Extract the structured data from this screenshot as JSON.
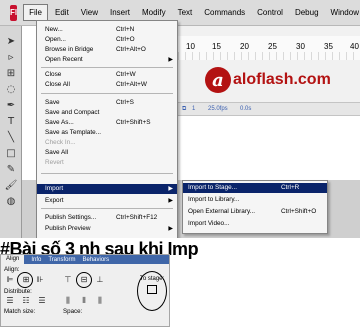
{
  "app": {
    "logo": "Fl"
  },
  "menubar": [
    "File",
    "Edit",
    "View",
    "Insert",
    "Modify",
    "Text",
    "Commands",
    "Control",
    "Debug",
    "Window"
  ],
  "ruler": [
    "10",
    "15",
    "20",
    "25",
    "30",
    "35",
    "40"
  ],
  "watermark": {
    "letter": "a",
    "text": "aloflash.com"
  },
  "status_strip": {
    "frame": "1",
    "fps": "25.0fps",
    "time": "0.0s"
  },
  "file_menu": [
    {
      "label": "New...",
      "shortcut": "Ctrl+N"
    },
    {
      "label": "Open...",
      "shortcut": "Ctrl+O"
    },
    {
      "label": "Browse in Bridge",
      "shortcut": "Ctrl+Alt+O"
    },
    {
      "label": "Open Recent",
      "submenu": true
    },
    {
      "label": "Close",
      "shortcut": "Ctrl+W"
    },
    {
      "label": "Close All",
      "shortcut": "Ctrl+Alt+W"
    },
    {
      "label": "Save",
      "shortcut": "Ctrl+S"
    },
    {
      "label": "Save and Compact"
    },
    {
      "label": "Save As...",
      "shortcut": "Ctrl+Shift+S"
    },
    {
      "label": "Save as Template..."
    },
    {
      "label": "Check In...",
      "disabled": true
    },
    {
      "label": "Save All"
    },
    {
      "label": "Revert",
      "disabled": true
    },
    {
      "label": "Import",
      "submenu": true,
      "highlighted": true
    },
    {
      "label": "Export",
      "submenu": true
    },
    {
      "label": "Publish Settings...",
      "shortcut": "Ctrl+Shift+F12"
    },
    {
      "label": "Publish Preview",
      "submenu": true
    }
  ],
  "import_submenu": [
    {
      "label": "Import to Stage...",
      "shortcut": "Ctrl+R",
      "highlighted": true
    },
    {
      "label": "Import to Library..."
    },
    {
      "label": "Open External Library...",
      "shortcut": "Ctrl+Shift+O"
    },
    {
      "label": "Import Video..."
    }
  ],
  "caption": "#Bài số 3 nh sau khi Imp",
  "align_panel": {
    "tabs": [
      "Align",
      "Info",
      "Transform",
      "Behaviors"
    ],
    "align_label": "Align:",
    "distribute_label": "Distribute:",
    "match_size_label": "Match size:",
    "space_label": "Space:",
    "to_stage_label": "To stage:"
  }
}
